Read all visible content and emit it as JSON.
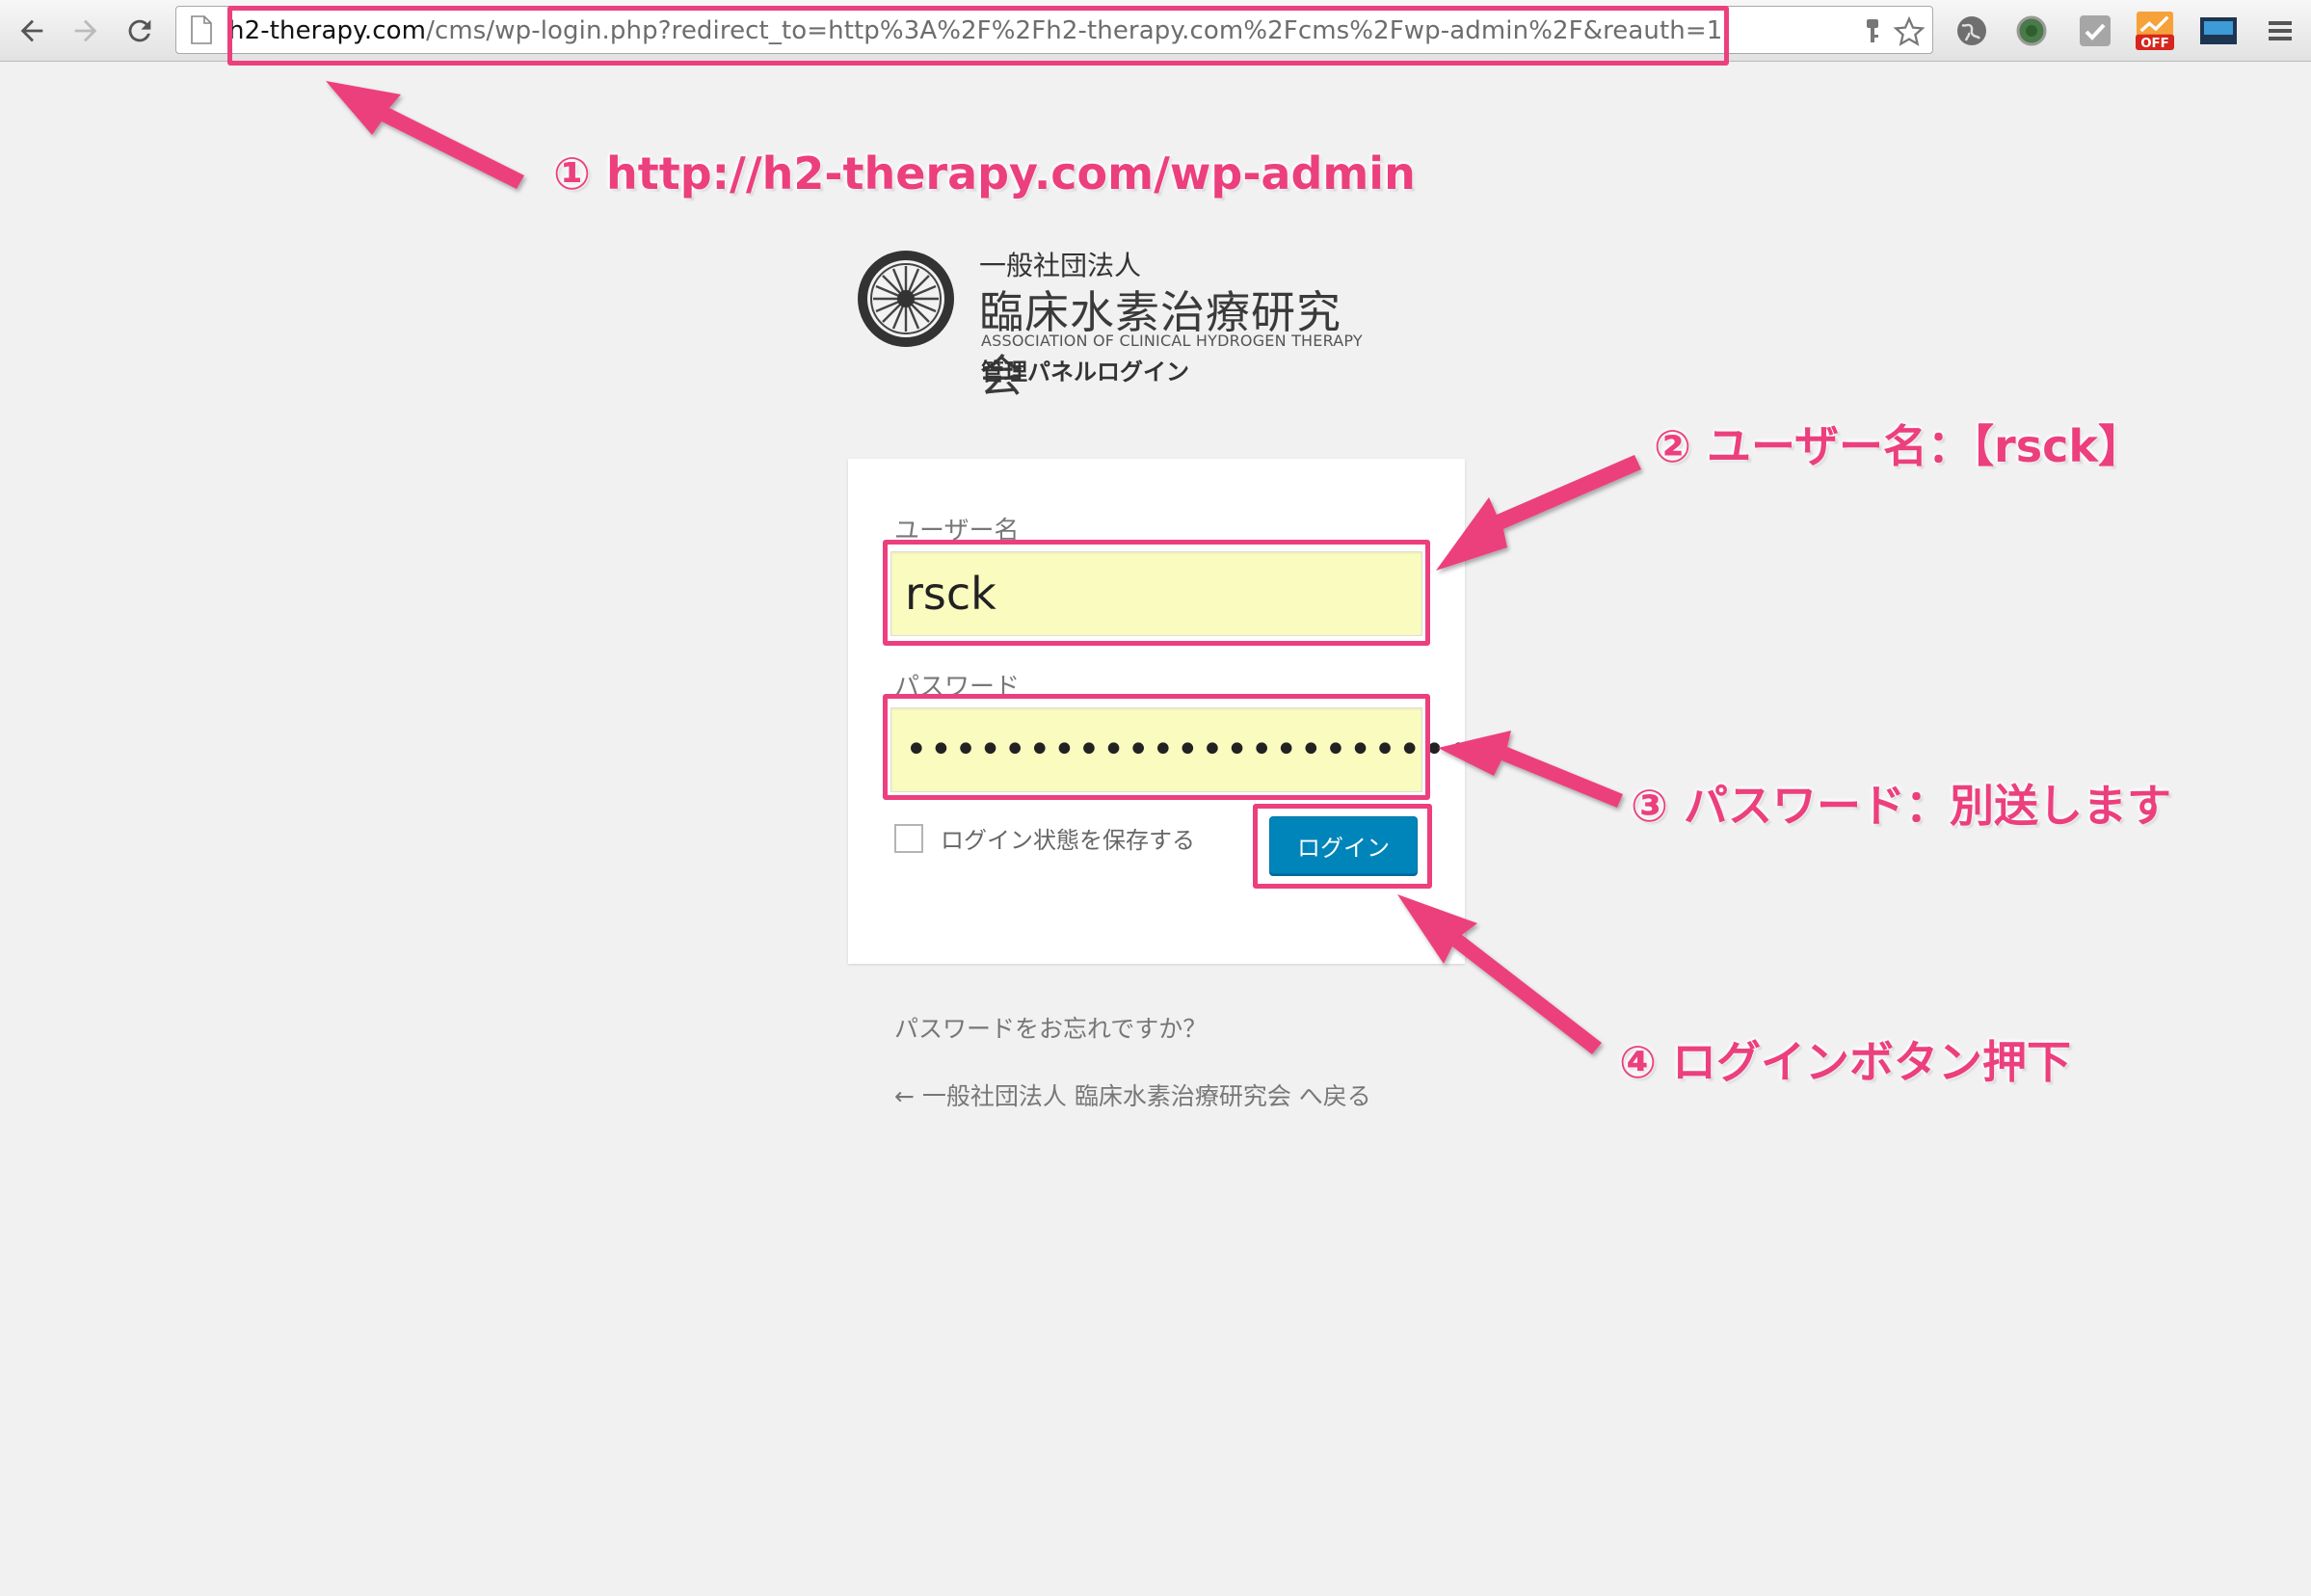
{
  "browser": {
    "url_host": "h2-therapy.com",
    "url_path": "/cms/wp-login.php?redirect_to=http%3A%2F%2Fh2-therapy.com%2Fcms%2Fwp-admin%2F&reauth=1",
    "off_badge": "OFF"
  },
  "logo": {
    "org_type": "一般社団法人",
    "org_name": "臨床水素治療研究会",
    "org_name_en": "ASSOCIATION OF CLINICAL HYDROGEN THERAPY",
    "subtitle": "管理パネルログイン"
  },
  "login": {
    "username_label": "ユーザー名",
    "username_value": "rsck",
    "password_label": "パスワード",
    "password_masked": "••••••••••••••••••••••••",
    "remember_label": "ログイン状態を保存する",
    "login_button": "ログイン",
    "forgot_link": "パスワードをお忘れですか？",
    "back_link": "← 一般社団法人 臨床水素治療研究会 へ戻る"
  },
  "annotations": {
    "step1": "① http://h2-therapy.com/wp-admin",
    "step2": "② ユーザー名：【rsck】",
    "step3": "③ パスワード：別送します",
    "step4": "④ ログインボタン押下"
  },
  "colors": {
    "annotation": "#ec3f7d",
    "button": "#0085ba",
    "autofill": "#fafbbf"
  }
}
